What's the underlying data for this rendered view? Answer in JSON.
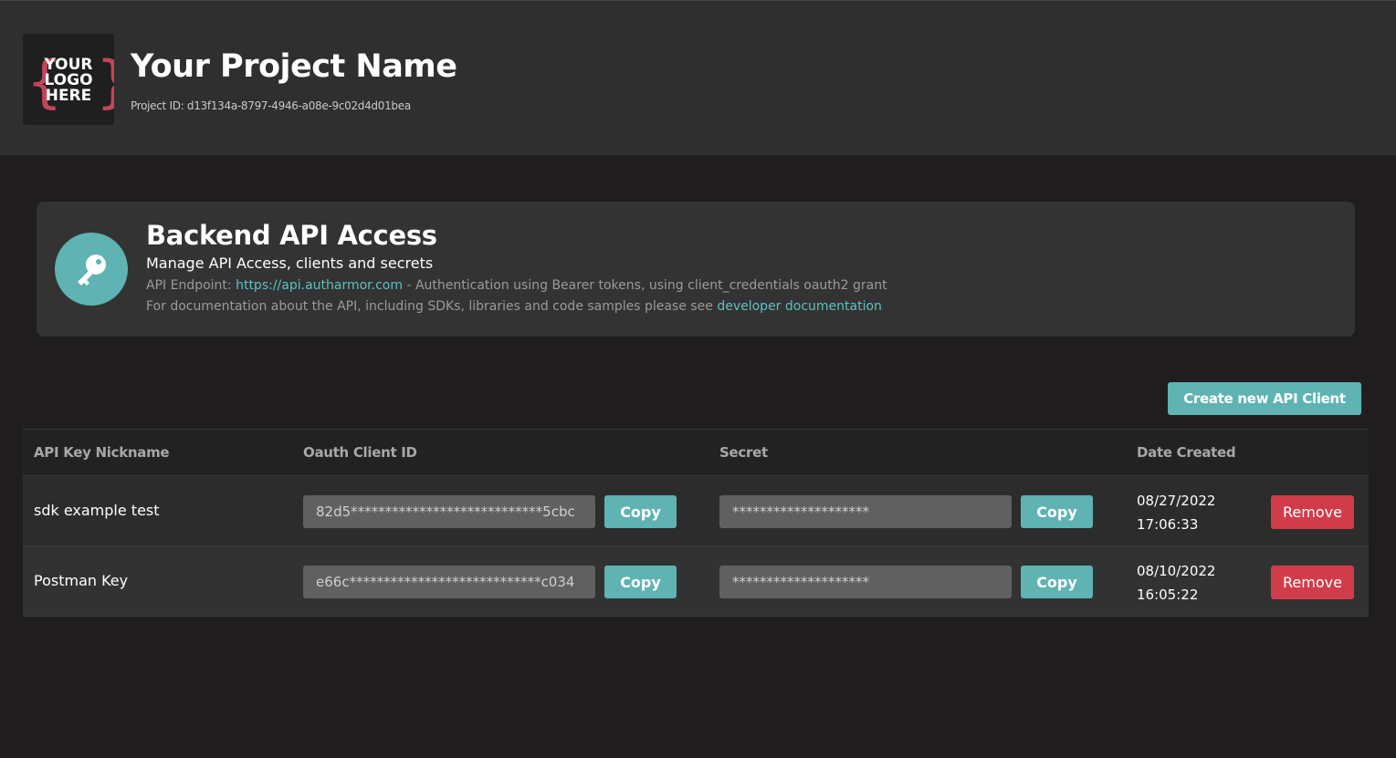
{
  "header": {
    "logo": {
      "line1": "YOUR",
      "line2": "LOGO",
      "line3": "HERE",
      "accent_color": "#c2455a"
    },
    "title": "Your Project Name",
    "project_id": "Project ID: d13f134a-8797-4946-a08e-9c02d4d01bea"
  },
  "info_card": {
    "icon": "key-icon",
    "icon_bg_color": "#5fb3b3",
    "title": "Backend API Access",
    "subtitle": "Manage API Access, clients and secrets",
    "endpoint_prefix": "API Endpoint: ",
    "endpoint_link": "https://api.autharmor.com",
    "endpoint_suffix": " - Authentication using Bearer tokens, using client_credentials oauth2 grant",
    "docs_prefix": "For documentation about the API, including SDKs, libraries and code samples please see ",
    "docs_link": "developer documentation"
  },
  "create_button": "Create new API Client",
  "table": {
    "headers": [
      "API Key Nickname",
      "Oauth Client ID",
      "Secret",
      "Date Created"
    ],
    "rows": [
      {
        "nickname": "sdk example test",
        "client_id": "82d5****************************5cbc",
        "secret": "********************",
        "copy_label": "Copy",
        "date": "08/27/2022",
        "time": "17:06:33",
        "remove_label": "Remove"
      },
      {
        "nickname": "Postman Key",
        "client_id": "e66c****************************c034",
        "secret": "********************",
        "copy_label": "Copy",
        "date": "08/10/2022",
        "time": "16:05:22",
        "remove_label": "Remove"
      }
    ]
  },
  "colors": {
    "accent": "#5fb3b3",
    "danger": "#d13c4a",
    "link": "#5fc0c0"
  }
}
